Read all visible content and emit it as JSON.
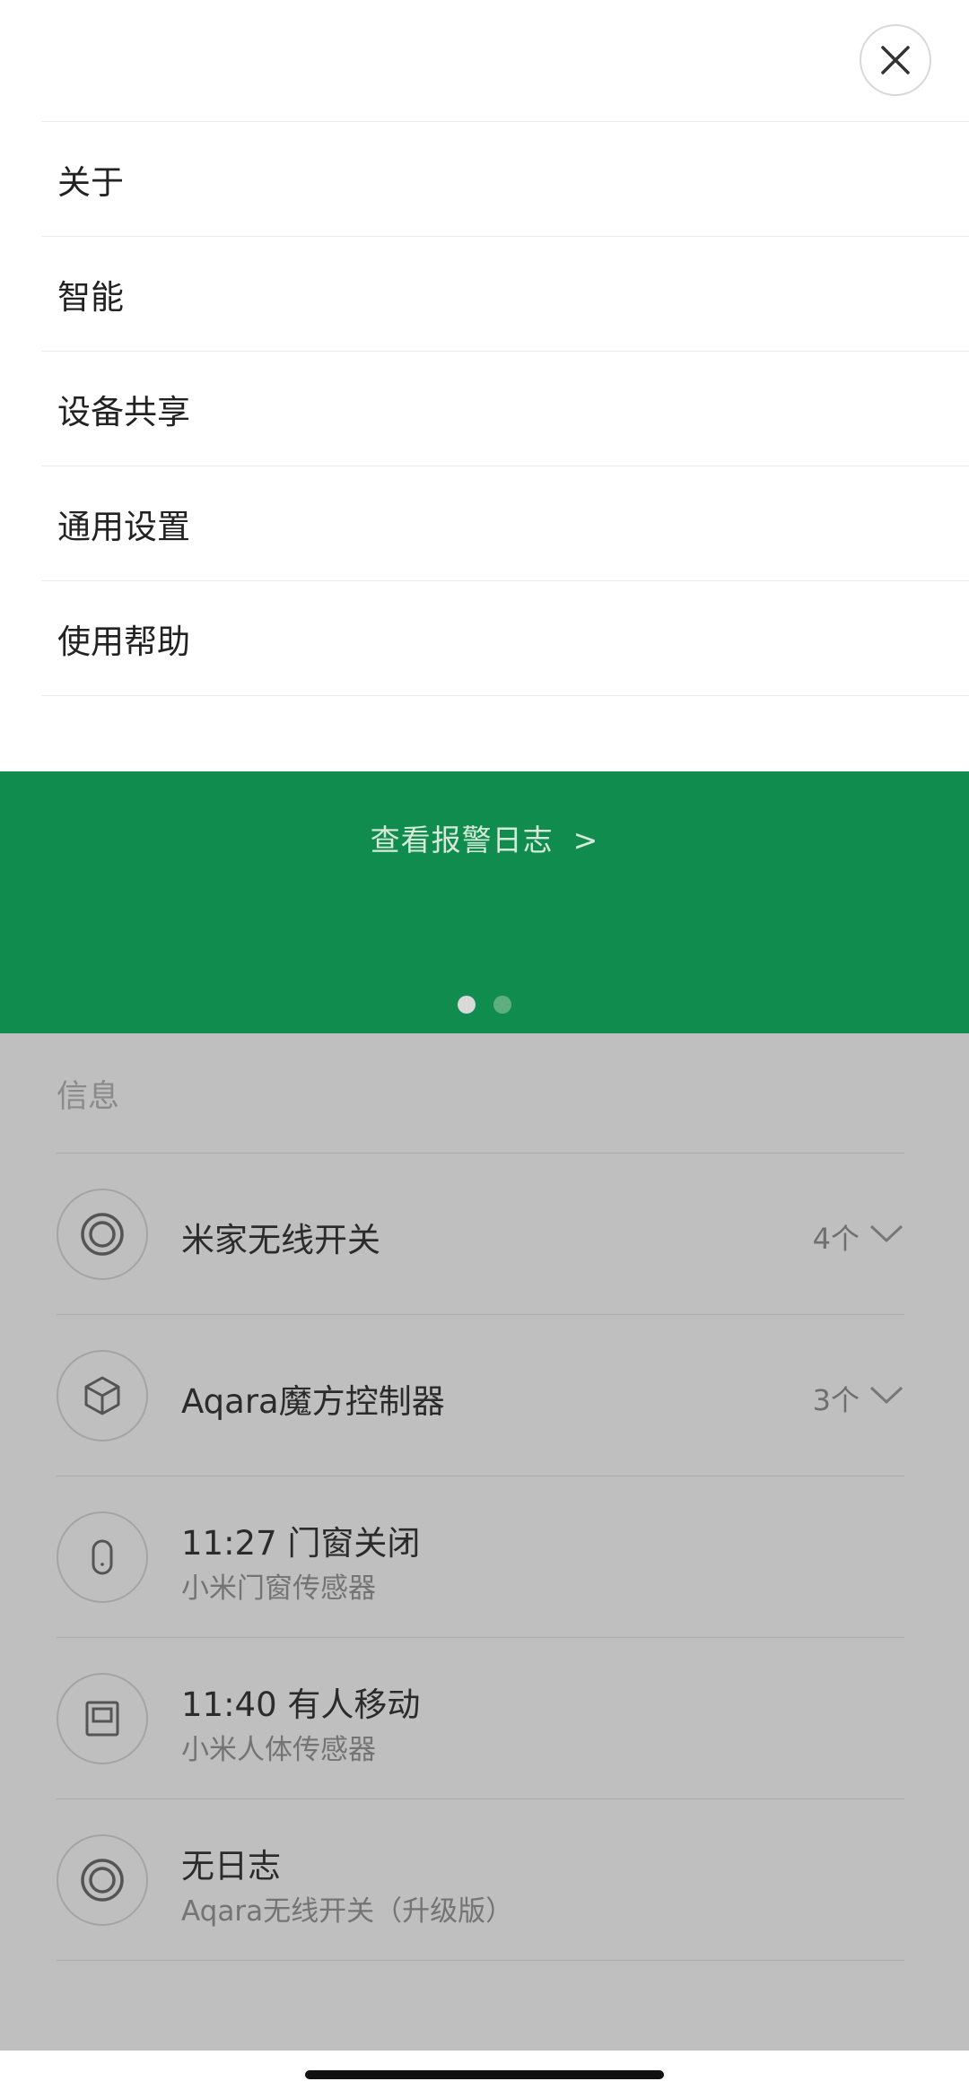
{
  "menu": {
    "items": [
      {
        "label": "关于"
      },
      {
        "label": "智能"
      },
      {
        "label": "设备共享"
      },
      {
        "label": "通用设置"
      },
      {
        "label": "使用帮助"
      }
    ]
  },
  "banner": {
    "link_label": "查看报警日志",
    "link_arrow": ">",
    "background_color": "#118c4f",
    "active_page": 1,
    "page_count": 2
  },
  "info": {
    "title": "信息",
    "devices": [
      {
        "name": "米家无线开关",
        "count": "4个",
        "icon": "ring-icon"
      },
      {
        "name": "Aqara魔方控制器",
        "count": "3个",
        "icon": "cube-icon"
      },
      {
        "title": "11:27 门窗关闭",
        "subtitle": "小米门窗传感器",
        "icon": "door-sensor-icon"
      },
      {
        "title": "11:40 有人移动",
        "subtitle": "小米人体传感器",
        "icon": "motion-sensor-icon"
      },
      {
        "title": "无日志",
        "subtitle": "Aqara无线开关（升级版）",
        "icon": "ring-icon"
      }
    ]
  }
}
